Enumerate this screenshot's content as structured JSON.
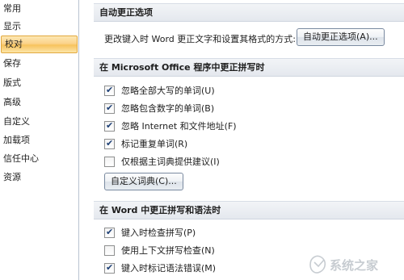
{
  "nav": {
    "items": [
      {
        "label": "常用",
        "selected": false
      },
      {
        "label": "显示",
        "selected": false
      },
      {
        "label": "校对",
        "selected": true
      },
      {
        "label": "保存",
        "selected": false
      },
      {
        "label": "版式",
        "selected": false
      },
      {
        "label": "高级",
        "selected": false
      },
      {
        "label": "自定义",
        "selected": false
      },
      {
        "label": "加载项",
        "selected": false
      },
      {
        "label": "信任中心",
        "selected": false
      },
      {
        "label": "资源",
        "selected": false
      }
    ]
  },
  "autocorrect": {
    "header": "自动更正选项",
    "description": "更改键入时 Word 更正文字和设置其格式的方式:",
    "button_label": "自动更正选项(A)..."
  },
  "office_spelling": {
    "header": "在 Microsoft Office 程序中更正拼写时",
    "options": [
      {
        "label": "忽略全部大写的单词(U)",
        "checked": true
      },
      {
        "label": "忽略包含数字的单词(B)",
        "checked": true
      },
      {
        "label": "忽略 Internet 和文件地址(F)",
        "checked": true
      },
      {
        "label": "标记重复单词(R)",
        "checked": true
      },
      {
        "label": "仅根据主词典提供建议(I)",
        "checked": false
      }
    ],
    "custom_dict_button": "自定义词典(C)..."
  },
  "word_grammar": {
    "header": "在 Word 中更正拼写和语法时",
    "options": [
      {
        "label": "键入时检查拼写(P)",
        "checked": true
      },
      {
        "label": "使用上下文拼写检查(N)",
        "checked": false
      },
      {
        "label": "键入时标记语法错误(M)",
        "checked": true
      }
    ]
  },
  "colors": {
    "selected_nav": "#f7c35d",
    "section_header_bg": "#e4e8ee",
    "checkmark": "#1d3f75"
  },
  "watermark": {
    "text": "系统之家"
  }
}
